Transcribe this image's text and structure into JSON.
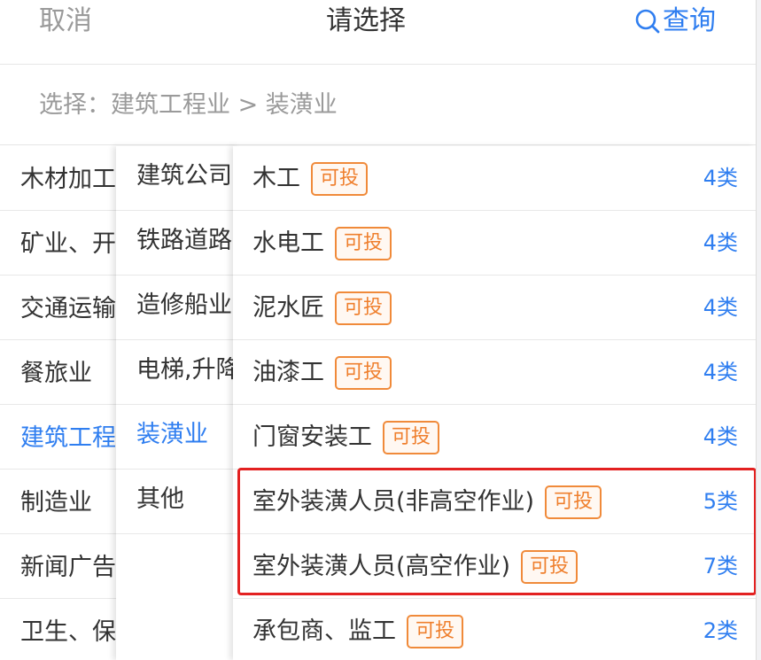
{
  "header": {
    "cancel_label": "取消",
    "title": "请选择",
    "query_label": "查询"
  },
  "breadcrumb": {
    "text": "选择：建筑工程业 > 装潢业"
  },
  "col1": {
    "items": [
      {
        "label": "木材加工"
      },
      {
        "label": "矿业、开"
      },
      {
        "label": "交通运输"
      },
      {
        "label": "餐旅业"
      },
      {
        "label": "建筑工程"
      },
      {
        "label": "制造业"
      },
      {
        "label": "新闻广告"
      },
      {
        "label": "卫生、保"
      }
    ],
    "active_index": 4
  },
  "col2": {
    "items": [
      {
        "label": "建筑公司"
      },
      {
        "label": "铁路道路"
      },
      {
        "label": "造修船业"
      },
      {
        "label": "电梯,升降"
      },
      {
        "label": "装潢业"
      },
      {
        "label": "其他"
      }
    ],
    "active_index": 4
  },
  "col3": {
    "items": [
      {
        "name": "木工",
        "badge": "可投",
        "count": "4类"
      },
      {
        "name": "水电工",
        "badge": "可投",
        "count": "4类"
      },
      {
        "name": "泥水匠",
        "badge": "可投",
        "count": "4类"
      },
      {
        "name": "油漆工",
        "badge": "可投",
        "count": "4类"
      },
      {
        "name": "门窗安装工",
        "badge": "可投",
        "count": "4类"
      },
      {
        "name": "室外装潢人员(非高空作业)",
        "badge": "可投",
        "count": "5类"
      },
      {
        "name": "室外装潢人员(高空作业)",
        "badge": "可投",
        "count": "7类"
      },
      {
        "name": "承包商、监工",
        "badge": "可投",
        "count": "2类"
      }
    ]
  },
  "colors": {
    "accent": "#2f7ef0",
    "badge": "#ef7f2d",
    "highlight": "#e32121",
    "muted_text": "#9a9a9a"
  },
  "icons": {
    "query": "search-icon"
  }
}
